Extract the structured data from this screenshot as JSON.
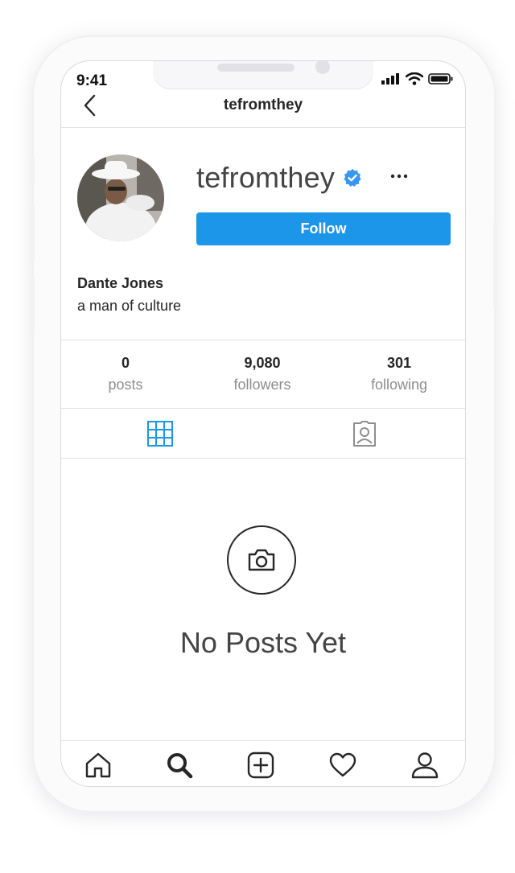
{
  "status_bar": {
    "time": "9:41"
  },
  "header": {
    "title": "tefromthey"
  },
  "profile": {
    "username": "tefromthey",
    "follow_label": "Follow",
    "full_name": "Dante Jones",
    "bio": "a man of culture"
  },
  "stats": [
    {
      "value": "0",
      "label": "posts"
    },
    {
      "value": "9,080",
      "label": "followers"
    },
    {
      "value": "301",
      "label": "following"
    }
  ],
  "empty_state": {
    "message": "No Posts Yet"
  },
  "colors": {
    "accent": "#1c96e8",
    "text": "#262626",
    "muted": "#8e8e8e",
    "divider": "#e3e3e3"
  },
  "tabs": [
    {
      "icon": "grid-icon",
      "active": true
    },
    {
      "icon": "tagged-photos-icon",
      "active": false
    }
  ],
  "bottom_nav": [
    {
      "icon": "home-icon"
    },
    {
      "icon": "search-icon"
    },
    {
      "icon": "new-post-icon"
    },
    {
      "icon": "heart-icon"
    },
    {
      "icon": "profile-icon"
    }
  ]
}
